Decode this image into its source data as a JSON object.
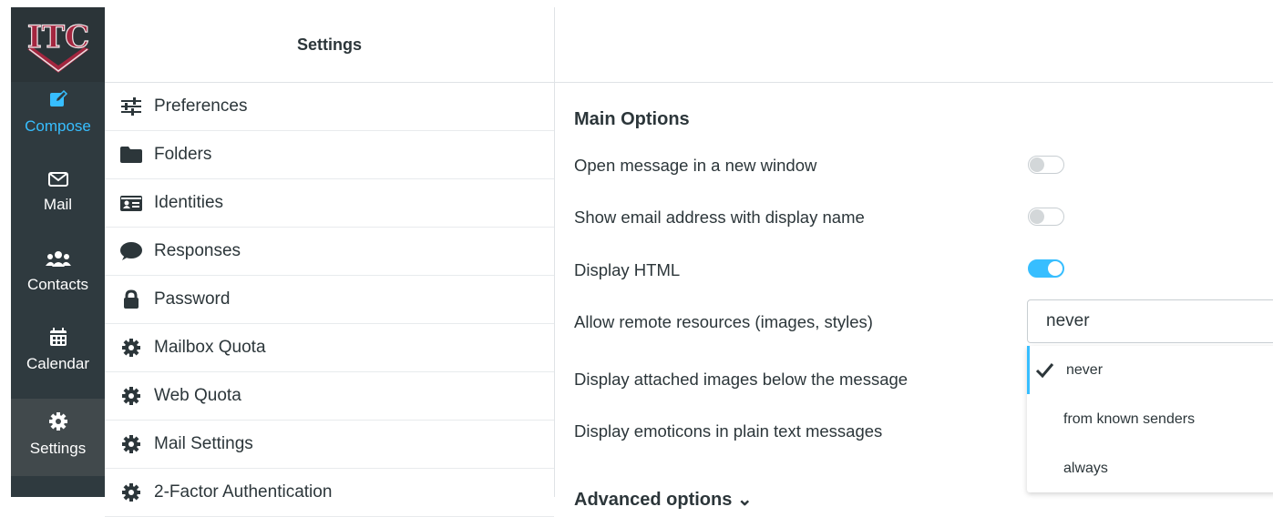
{
  "nav": {
    "logo_text": "ITC",
    "items": [
      {
        "label": "Compose",
        "icon": "compose-icon"
      },
      {
        "label": "Mail",
        "icon": "envelope-icon"
      },
      {
        "label": "Contacts",
        "icon": "users-icon"
      },
      {
        "label": "Calendar",
        "icon": "calendar-icon"
      },
      {
        "label": "Settings",
        "icon": "gear-icon"
      }
    ]
  },
  "settings": {
    "header": "Settings",
    "items": [
      {
        "label": "Preferences",
        "icon": "sliders-icon"
      },
      {
        "label": "Folders",
        "icon": "folder-icon"
      },
      {
        "label": "Identities",
        "icon": "id-card-icon"
      },
      {
        "label": "Responses",
        "icon": "comment-icon"
      },
      {
        "label": "Password",
        "icon": "lock-icon"
      },
      {
        "label": "Mailbox Quota",
        "icon": "gear-icon"
      },
      {
        "label": "Web Quota",
        "icon": "gear-icon"
      },
      {
        "label": "Mail Settings",
        "icon": "gear-icon"
      },
      {
        "label": "2-Factor Authentication",
        "icon": "gear-icon"
      }
    ]
  },
  "main": {
    "section_title": "Main Options",
    "options": [
      {
        "label": "Open message in a new window",
        "toggle": false
      },
      {
        "label": "Show email address with display name",
        "toggle": false
      },
      {
        "label": "Display HTML",
        "toggle": true
      },
      {
        "label": "Allow remote resources (images, styles)"
      },
      {
        "label": "Display attached images below the message"
      },
      {
        "label": "Display emoticons in plain text messages"
      }
    ],
    "remote_select": {
      "value": "never",
      "options": [
        "never",
        "from known senders",
        "always"
      ],
      "selected_index": 0
    },
    "advanced_title": "Advanced options ⌄"
  },
  "colors": {
    "accent": "#37beff",
    "nav_bg": "#2f3a3f",
    "logo_red": "#a3263f"
  }
}
